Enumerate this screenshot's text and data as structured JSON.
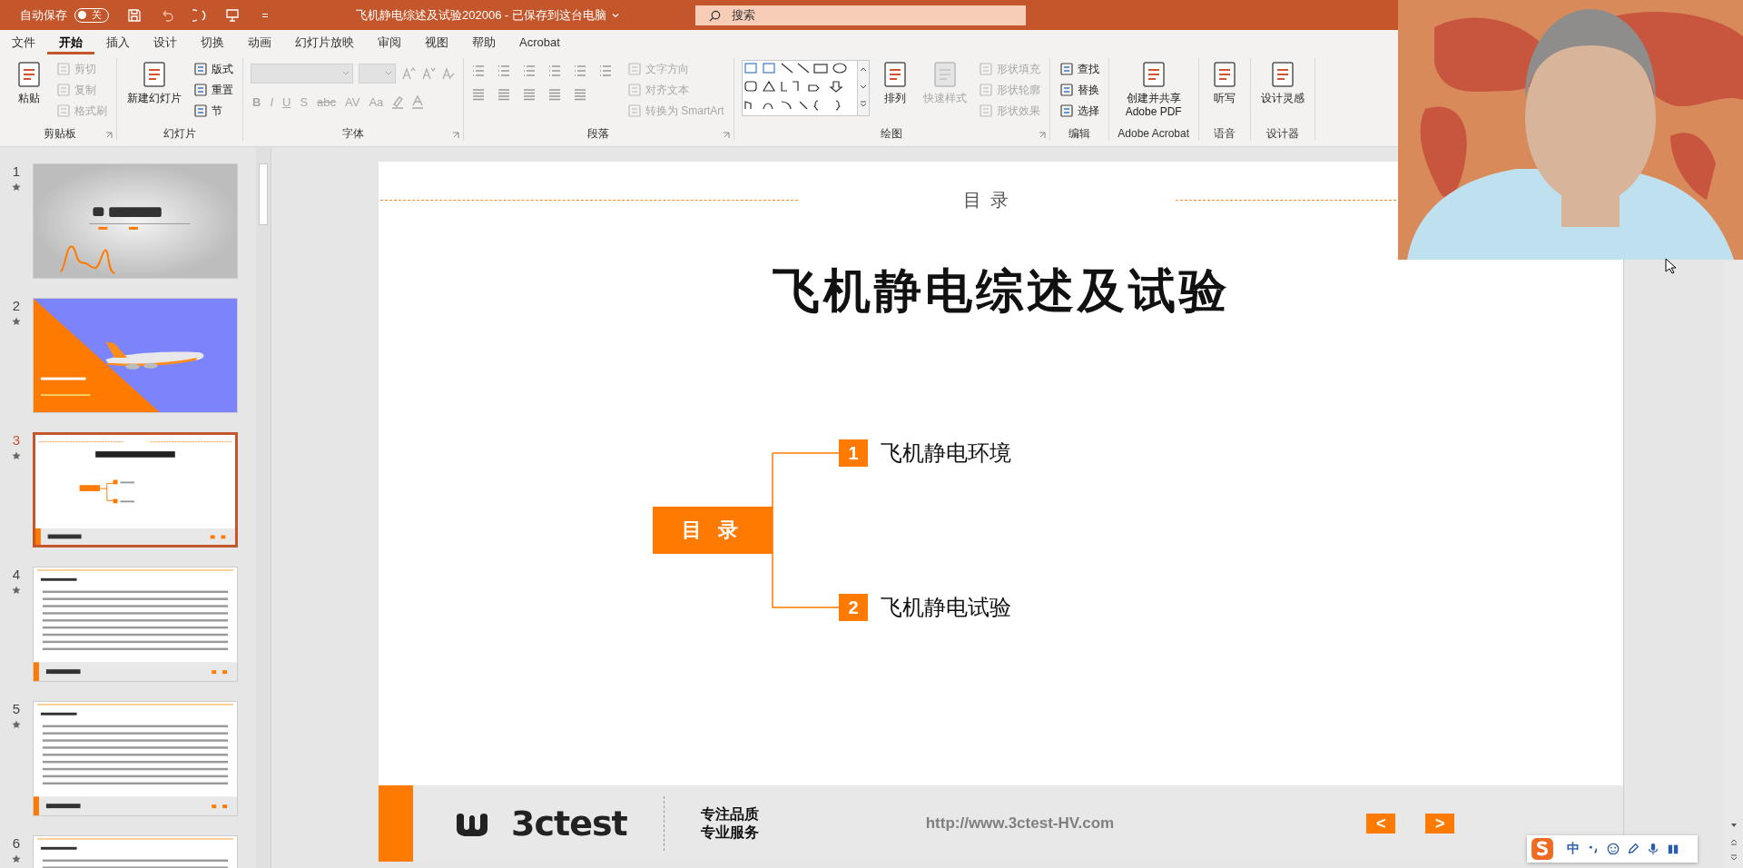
{
  "title_bar": {
    "autosave_label": "自动保存",
    "autosave_on": false,
    "autosave_state": "关",
    "document_title": "飞机静电综述及试验202006 - 已保存到这台电脑",
    "search_placeholder": "搜索"
  },
  "ribbon_tabs": [
    {
      "label": "文件",
      "selected": false
    },
    {
      "label": "开始",
      "selected": true
    },
    {
      "label": "插入",
      "selected": false
    },
    {
      "label": "设计",
      "selected": false
    },
    {
      "label": "切换",
      "selected": false
    },
    {
      "label": "动画",
      "selected": false
    },
    {
      "label": "幻灯片放映",
      "selected": false
    },
    {
      "label": "审阅",
      "selected": false
    },
    {
      "label": "视图",
      "selected": false
    },
    {
      "label": "帮助",
      "selected": false
    },
    {
      "label": "Acrobat",
      "selected": false
    }
  ],
  "ribbon_groups": [
    {
      "label": "剪贴板",
      "launcher": true,
      "columns": [
        {
          "kind": "large",
          "label": "粘贴",
          "disabled": false
        },
        {
          "kind": "stack",
          "items": [
            {
              "label": "剪切",
              "disabled": true
            },
            {
              "label": "复制",
              "disabled": true
            },
            {
              "label": "格式刷",
              "disabled": true
            }
          ]
        }
      ]
    },
    {
      "label": "幻灯片",
      "launcher": false,
      "columns": [
        {
          "kind": "large",
          "label": "新建幻灯片",
          "disabled": false
        },
        {
          "kind": "stack",
          "items": [
            {
              "label": "版式",
              "disabled": false
            },
            {
              "label": "重置",
              "disabled": false
            },
            {
              "label": "节",
              "disabled": false
            }
          ]
        }
      ]
    },
    {
      "label": "字体",
      "launcher": true,
      "columns": [
        {
          "kind": "font",
          "glyphs": [
            {
              "label": "B",
              "disabled": true
            },
            {
              "label": "I",
              "disabled": true
            },
            {
              "label": "U",
              "disabled": true
            },
            {
              "label": "S",
              "disabled": true
            },
            {
              "label": "abc",
              "disabled": true
            },
            {
              "label": "AV",
              "disabled": true
            },
            {
              "label": "Aa",
              "disabled": true
            }
          ]
        }
      ]
    },
    {
      "label": "段落",
      "launcher": true,
      "columns": [
        {
          "kind": "paragraph"
        },
        {
          "kind": "stack",
          "items": [
            {
              "label": "文字方向",
              "disabled": true
            },
            {
              "label": "对齐文本",
              "disabled": true
            },
            {
              "label": "转换为 SmartArt",
              "disabled": true
            }
          ]
        }
      ]
    },
    {
      "label": "绘图",
      "launcher": true,
      "columns": [
        {
          "kind": "gallery"
        },
        {
          "kind": "large",
          "label": "排列",
          "disabled": false
        },
        {
          "kind": "large",
          "label": "快速样式",
          "disabled": true
        },
        {
          "kind": "stack",
          "items": [
            {
              "label": "形状填充",
              "disabled": true
            },
            {
              "label": "形状轮廓",
              "disabled": true
            },
            {
              "label": "形状效果",
              "disabled": true
            }
          ]
        }
      ]
    },
    {
      "label": "编辑",
      "launcher": false,
      "columns": [
        {
          "kind": "stack",
          "items": [
            {
              "label": "查找",
              "disabled": false
            },
            {
              "label": "替换",
              "disabled": false
            },
            {
              "label": "选择",
              "disabled": false
            }
          ]
        }
      ]
    },
    {
      "label": "Adobe Acrobat",
      "launcher": false,
      "columns": [
        {
          "kind": "large",
          "label": "创建并共享 Adobe PDF",
          "disabled": false
        }
      ]
    },
    {
      "label": "语音",
      "launcher": false,
      "columns": [
        {
          "kind": "large",
          "label": "听写",
          "disabled": false
        }
      ]
    },
    {
      "label": "设计器",
      "launcher": false,
      "columns": [
        {
          "kind": "large",
          "label": "设计灵感",
          "disabled": false
        }
      ]
    }
  ],
  "thumbnails": [
    {
      "number": "1",
      "kind": "logo",
      "selected": false
    },
    {
      "number": "2",
      "kind": "airplane",
      "selected": false
    },
    {
      "number": "3",
      "kind": "toc",
      "selected": true
    },
    {
      "number": "4",
      "kind": "text",
      "selected": false
    },
    {
      "number": "5",
      "kind": "text",
      "selected": false
    },
    {
      "number": "6",
      "kind": "text",
      "selected": false
    }
  ],
  "slide": {
    "header": "目 录",
    "title": "飞机静电综述及试验",
    "center_label": "目 录",
    "items": [
      {
        "number": "1",
        "label": "飞机静电环境"
      },
      {
        "number": "2",
        "label": "飞机静电试验"
      }
    ],
    "footer": {
      "brand": "3ctest",
      "slogans": [
        "专注品质",
        "专业服务"
      ],
      "url": "http://www.3ctest-HV.com",
      "prev": "<",
      "next": ">"
    }
  },
  "ime_bar": {
    "mode": "中"
  }
}
